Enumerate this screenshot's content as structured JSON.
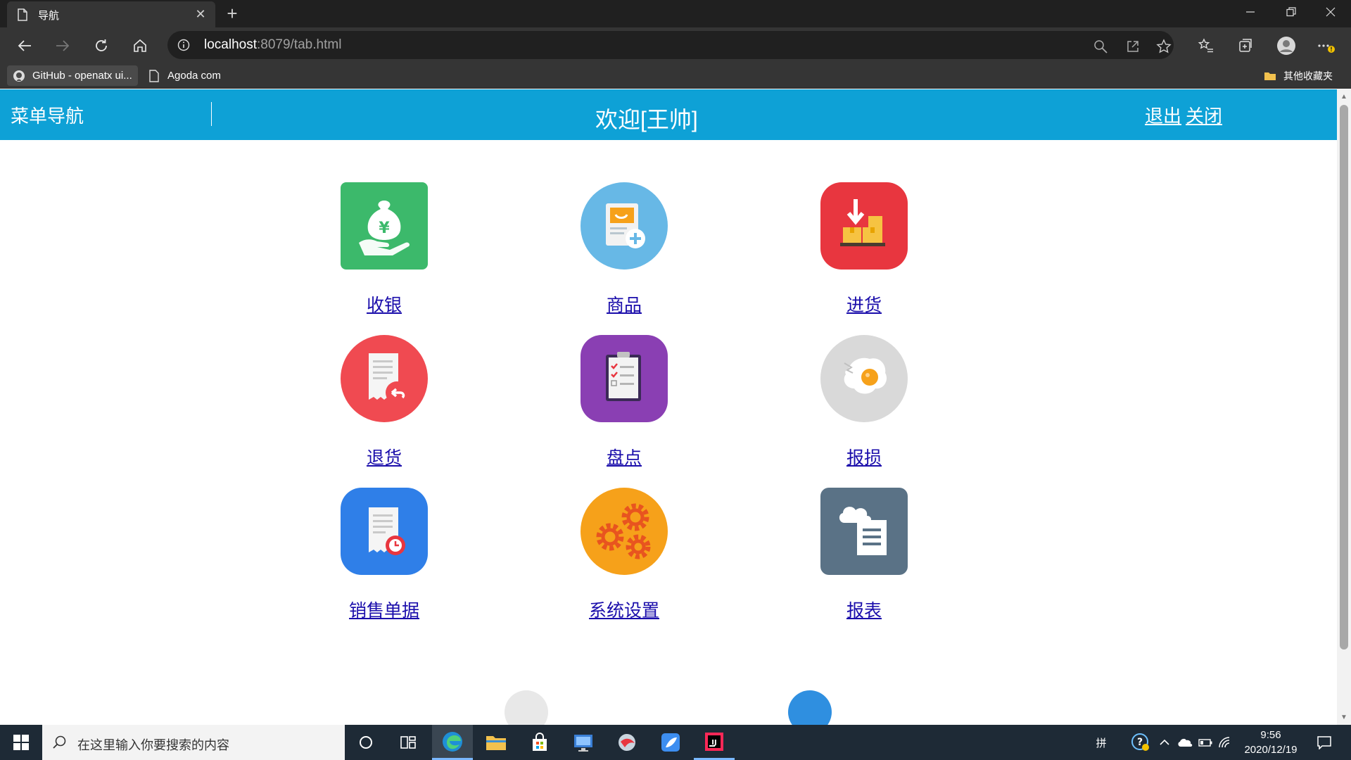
{
  "browser": {
    "tab_title": "导航",
    "new_tab_symbol": "+",
    "close_symbol": "✕",
    "url_host": "localhost",
    "url_rest": ":8079/tab.html",
    "bookmarks": [
      {
        "label": "GitHub - openatx ui...",
        "icon": "github-icon"
      },
      {
        "label": "Agoda com",
        "icon": "page-icon"
      }
    ],
    "other_bookmarks": "其他收藏夹"
  },
  "header": {
    "menu_title": "菜单导航",
    "welcome": "欢迎[王帅]",
    "logout": "退出",
    "close": "关闭",
    "background": "#0ea1d6"
  },
  "menu": {
    "items": [
      {
        "label": "收银",
        "icon": "money-bag-icon",
        "color": "#3cb96b"
      },
      {
        "label": "商品",
        "icon": "product-add-icon",
        "color": "#67b8e6"
      },
      {
        "label": "进货",
        "icon": "purchase-icon",
        "color": "#e8363f"
      },
      {
        "label": "退货",
        "icon": "return-receipt-icon",
        "color": "#f04a51"
      },
      {
        "label": "盘点",
        "icon": "checklist-icon",
        "color": "#8a3fb3"
      },
      {
        "label": "报损",
        "icon": "broken-egg-icon",
        "color": "#d9d9d9"
      },
      {
        "label": "销售单据",
        "icon": "sales-receipt-icon",
        "color": "#2f7fe8"
      },
      {
        "label": "系统设置",
        "icon": "gears-icon",
        "color": "#f6a11a"
      },
      {
        "label": "报表",
        "icon": "cloud-report-icon",
        "color": "#5a7286"
      }
    ]
  },
  "taskbar": {
    "search_placeholder": "在这里输入你要搜索的内容",
    "ime": "拼",
    "time": "9:56",
    "date": "2020/12/19"
  }
}
